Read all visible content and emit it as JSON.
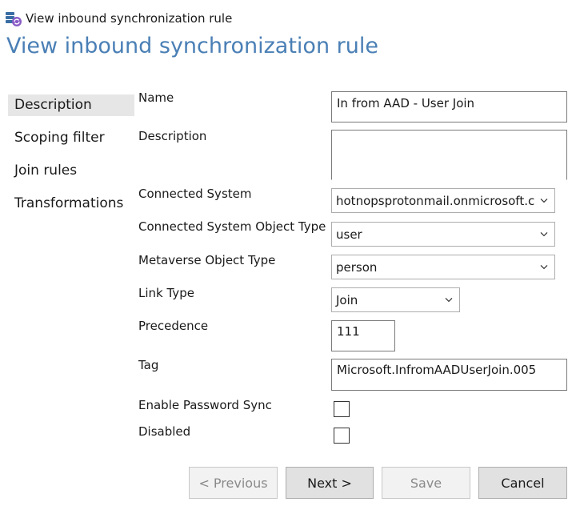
{
  "window": {
    "title": "View inbound synchronization rule"
  },
  "page": {
    "title": "View inbound synchronization rule"
  },
  "nav": {
    "items": [
      {
        "label": "Description"
      },
      {
        "label": "Scoping filter"
      },
      {
        "label": "Join rules"
      },
      {
        "label": "Transformations"
      }
    ]
  },
  "form": {
    "name_label": "Name",
    "name_value": "In from AAD - User Join",
    "description_label": "Description",
    "description_value": "",
    "connected_system_label": "Connected System",
    "connected_system_value": "hotnopsprotonmail.onmicrosoft.c",
    "cs_object_type_label": "Connected System Object Type",
    "cs_object_type_value": "user",
    "mv_object_type_label": "Metaverse Object Type",
    "mv_object_type_value": "person",
    "link_type_label": "Link Type",
    "link_type_value": "Join",
    "precedence_label": "Precedence",
    "precedence_value": "111",
    "tag_label": "Tag",
    "tag_value": "Microsoft.InfromAADUserJoin.005",
    "enable_password_sync_label": "Enable Password Sync",
    "disabled_label": "Disabled"
  },
  "buttons": {
    "previous": "< Previous",
    "next": "Next >",
    "save": "Save",
    "cancel": "Cancel"
  },
  "colors": {
    "title_blue": "#4a7fb5",
    "nav_selected": "#e6e6e6"
  }
}
